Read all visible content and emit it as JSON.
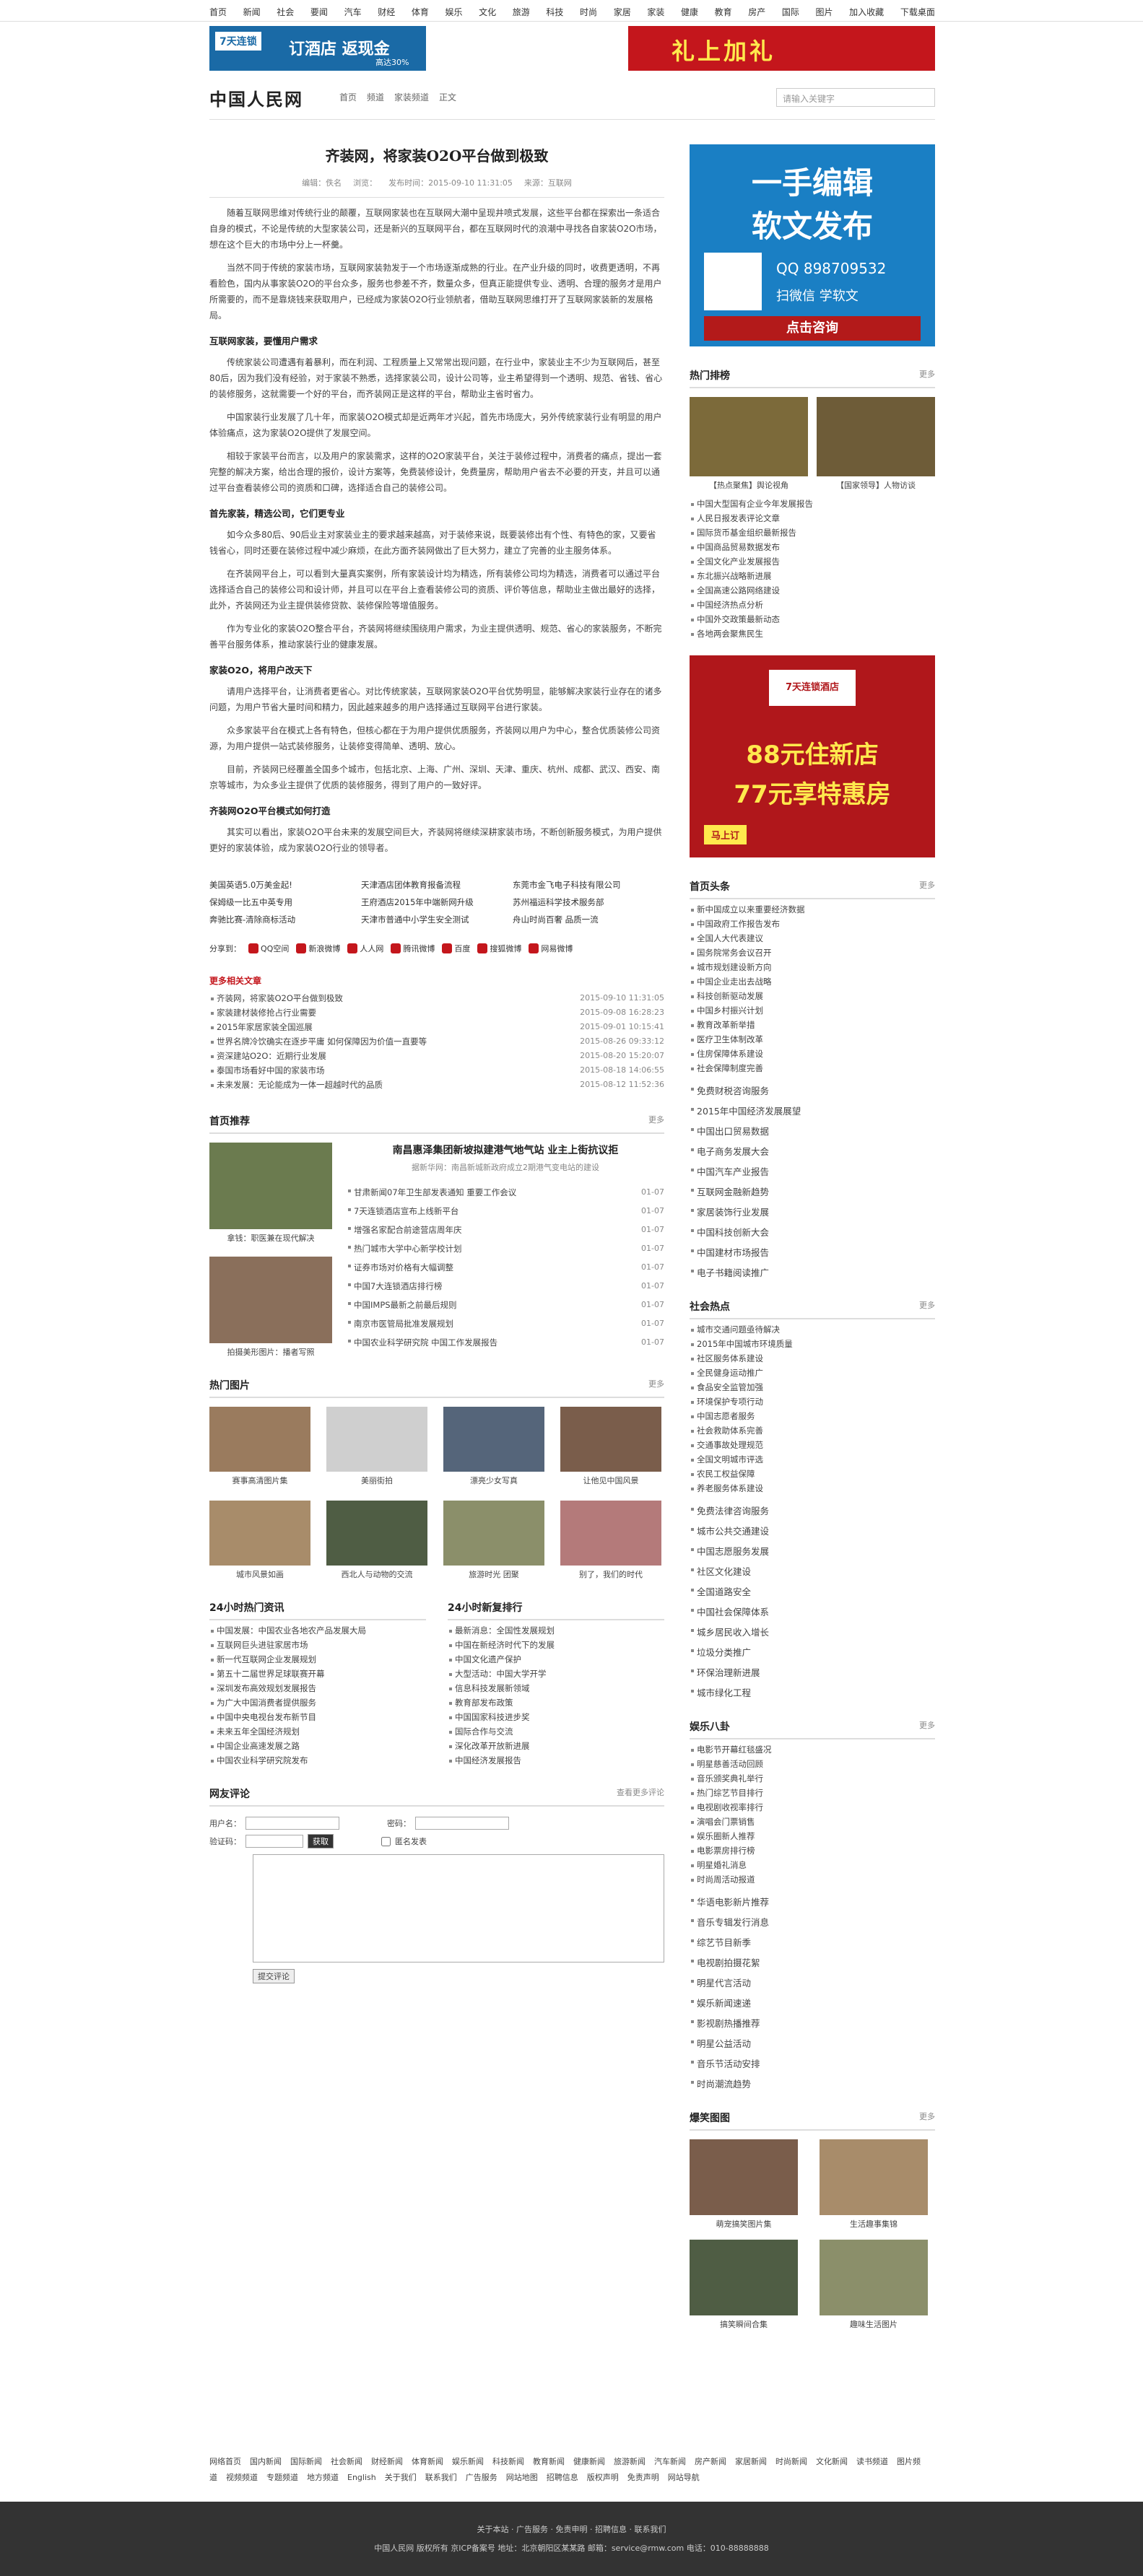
{
  "topnav": [
    "首页",
    "新闻",
    "社会",
    "要闻",
    "汽车",
    "财经",
    "体育",
    "娱乐",
    "文化",
    "旅游",
    "科技",
    "时尚",
    "家居",
    "家装",
    "健康",
    "教育",
    "房产",
    "国际",
    "图片",
    "加入收藏",
    "下载桌面"
  ],
  "ads": {
    "banner_left_tag": "7天连锁",
    "banner_left_text": "订酒店 返现金",
    "banner_left_small": "高达30%",
    "banner_right_text": "礼上加礼"
  },
  "logo": "中国人民网",
  "breadcrumb": [
    "首页",
    "频道",
    "家装频道",
    "正文"
  ],
  "search": {
    "placeholder": "请输入关键字"
  },
  "article": {
    "title": "齐装网，将家装O2O平台做到极致",
    "meta": [
      "编辑：佚名",
      "浏览：",
      "发布时间：2015-09-10 11:31:05",
      "来源：互联网"
    ],
    "paras": [
      "随着互联网思维对传统行业的颠覆，互联网家装也在互联网大潮中呈现井喷式发展，这些平台都在探索出一条适合自身的模式，不论是传统的大型家装公司，还是新兴的互联网平台，都在互联网时代的浪潮中寻找各自家装O2O市场，想在这个巨大的市场中分上一杯羹。",
      "当然不同于传统的家装市场，互联网家装勃发于一个市场逐渐成熟的行业。在产业升级的同时，收费更透明，不再看脸色，国内从事家装O2O的平台众多，服务也参差不齐，数量众多，但真正能提供专业、透明、合理的服务才是用户所需要的，而不是靠烧钱来获取用户，已经成为家装O2O行业领航者，借助互联网思维打开了互联网家装新的发展格局。",
      "传统家装公司遭遇有着暴利，而在利润、工程质量上又常常出现问题，在行业中，家装业主不少为互联网后，甚至80后，因为我们没有经验，对于家装不熟悉，选择家装公司，设计公司等，业主希望得到一个透明、规范、省钱、省心的装修服务，这就需要一个好的平台，而齐装网正是这样的平台，帮助业主省时省力。",
      "中国家装行业发展了几十年，而家装O2O模式却是近两年才兴起，首先市场庞大，另外传统家装行业有明显的用户体验痛点，这为家装O2O提供了发展空间。",
      "相较于家装平台而言，以及用户的家装需求，这样的O2O家装平台，关注于装修过程中，消费者的痛点，提出一套完整的解决方案，给出合理的报价，设计方案等，免费装修设计，免费量房，帮助用户省去不必要的开支，并且可以通过平台查看装修公司的资质和口碑，选择适合自己的装修公司。",
      "如今众多80后、90后业主对家装业主的要求越来越高，对于装修来说，既要装修出有个性、有特色的家，又要省钱省心，同时还要在装修过程中减少麻烦，在此方面齐装网做出了巨大努力，建立了完善的业主服务体系。",
      "在齐装网平台上，可以看到大量真实案例，所有家装设计均为精选，所有装修公司均为精选，消费者可以通过平台选择适合自己的装修公司和设计师，并且可以在平台上查看装修公司的资质、评价等信息，帮助业主做出最好的选择，此外，齐装网还为业主提供装修贷款、装修保险等增值服务。",
      "作为专业化的家装O2O整合平台，齐装网将继续围绕用户需求，为业主提供透明、规范、省心的家装服务，不断完善平台服务体系，推动家装行业的健康发展。",
      "请用户选择平台，让消费者更省心。对比传统家装，互联网家装O2O平台优势明显，能够解决家装行业存在的诸多问题，为用户节省大量时间和精力，因此越来越多的用户选择通过互联网平台进行家装。",
      "众多家装平台在模式上各有特色，但核心都在于为用户提供优质服务，齐装网以用户为中心，整合优质装修公司资源，为用户提供一站式装修服务，让装修变得简单、透明、放心。",
      "目前，齐装网已经覆盖全国多个城市，包括北京、上海、广州、深圳、天津、重庆、杭州、成都、武汉、西安、南京等城市，为众多业主提供了优质的装修服务，得到了用户的一致好评。",
      "其实可以看出，家装O2O平台未来的发展空间巨大，齐装网将继续深耕家装市场，不断创新服务模式，为用户提供更好的家装体验，成为家装O2O行业的领导者。"
    ],
    "subheads": [
      "互联网家装，要懂用户需求",
      "首先家装，精选公司，它们更专业",
      "家装O2O，将用户改天下",
      "齐装网O2O平台模式如何打造"
    ]
  },
  "ad_links": [
    [
      "美国英语5.0万美金起!",
      "天津酒店团体教育报备流程",
      "东莞市金飞电子科技有限公司"
    ],
    [
      "保姆级一比五中英专用",
      "王府酒店2015年中端新网升级",
      "苏州福运科学技术服务部"
    ],
    [
      "奔驰比赛-清除商标活动",
      "天津市普通中小学生安全测试",
      "舟山时尚百奢 品质一流"
    ]
  ],
  "share": {
    "label": "分享到：",
    "items": [
      "QQ空间",
      "新浪微博",
      "人人网",
      "腾讯微博",
      "百度",
      "搜狐微博",
      "网易微博"
    ]
  },
  "related": {
    "title": "更多相关文章",
    "items": [
      [
        "齐装网，将家装O2O平台做到极致",
        "2015-09-10 11:31:05"
      ],
      [
        "家装建材装修抢占行业需要",
        "2015-09-08 16:28:23"
      ],
      [
        "2015年家居家装全国巡展",
        "2015-09-01 10:15:41"
      ],
      [
        "世界名牌冷饮确实在逐步平庸 如何保障因为价值一直要等",
        "2015-08-26 09:33:12"
      ],
      [
        "资深建站O2O：近期行业发展",
        "2015-08-20 15:20:07"
      ],
      [
        "泰国市场看好中国的家装市场",
        "2015-08-18 14:06:55"
      ],
      [
        "未来发展：无论能成为一体一超越时代的品质",
        "2015-08-12 11:52:36"
      ]
    ]
  },
  "home_rec": {
    "title": "首页推荐",
    "more": "更多",
    "headline": "南昌惠泽集团新坡拟建港气地气站 业主上街抗议拒",
    "headline_desc": "据新华网：南昌新城新政府成立2期港气变电站的建设",
    "thumb1_caption": "拿钱：职医兼在现代解决",
    "thumb2_caption": "拍摄美形图片：播者写照",
    "list": [
      [
        "甘肃新闻07年卫生部发表通知 重要工作会议",
        "01-07"
      ],
      [
        "7天连锁酒店宣布上线新平台",
        "01-07"
      ],
      [
        "增强名家配合前途营店周年庆",
        "01-07"
      ],
      [
        "热门城市大学中心新学校计划",
        "01-07"
      ],
      [
        "证券市场对价格有大幅调整",
        "01-07"
      ],
      [
        "中国7大连锁酒店排行榜",
        "01-07"
      ],
      [
        "中国IMPS最新之前最后规则",
        "01-07"
      ],
      [
        "南京市医管局批准发展规划",
        "01-07"
      ],
      [
        "中国农业科学研究院 中国工作发展报告",
        "01-07"
      ]
    ]
  },
  "hot_images": {
    "title": "热门图片",
    "more": "更多",
    "items": [
      "赛事高清图片集",
      "美丽街拍",
      "漂亮少女写真",
      "让他见中国风景",
      "城市风景如画",
      "西北人与动物的交流",
      "旅游时光 团聚",
      "别了，我们的时代"
    ]
  },
  "top24": {
    "title": "24小时热门资讯",
    "items": [
      "中国发展：中国农业各地农产品发展大局",
      "互联网巨头进驻家居市场",
      "新一代互联网企业发展规划",
      "第五十二届世界足球联赛开幕",
      "深圳发布高效规划发展报告",
      "为广大中国消费者提供服务",
      "中国中央电视台发布新节目",
      "未来五年全国经济规划",
      "中国企业高速发展之路",
      "中国农业科学研究院发布"
    ]
  },
  "top24b": {
    "title": "24小时新复排行",
    "items": [
      "最新消息：全国性发展规划",
      "中国在新经济时代下的发展",
      "中国文化遗产保护",
      "大型活动：中国大学开学",
      "信息科技发展新领域",
      "教育部发布政策",
      "中国国家科技进步奖",
      "国际合作与交流",
      "深化改革开放新进展",
      "中国经济发展报告"
    ]
  },
  "comments": {
    "title": "网友评论",
    "link": "查看更多评论",
    "user_label": "用户名：",
    "pwd_label": "密码：",
    "code_label": "验证码：",
    "anon_label": "匿名发表",
    "submit": "提交评论",
    "verify_btn": "获取"
  },
  "sidebar": {
    "ad1": {
      "line1": "一手编辑",
      "line2": "软文发布",
      "qq": "QQ 898709532",
      "wechat": "扫微信 学软文",
      "cta": "点击咨询"
    },
    "hot_rank": {
      "title": "热门排榜",
      "more": "更多",
      "thumbs": [
        "【热点聚焦】舆论视角",
        "【国家领导】人物访谈"
      ],
      "items": [
        "中国大型国有企业今年发展报告",
        "人民日报发表评论文章",
        "国际货币基金组织最新报告",
        "中国商品贸易数据发布",
        "全国文化产业发展报告",
        "东北振兴战略新进展",
        "全国高速公路网络建设",
        "中国经济热点分析",
        "中国外交政策最新动态",
        "各地两会聚焦民生"
      ]
    },
    "ad2": {
      "brand": "7天连锁酒店",
      "line1": "88元住新店",
      "line2": "77元享特惠房",
      "cta": "马上订"
    },
    "headlines": {
      "title": "首页头条",
      "more": "更多",
      "items": [
        "新中国成立以来重要经济数据",
        "中国政府工作报告发布",
        "全国人大代表建议",
        "国务院常务会议召开",
        "城市规划建设新方向",
        "中国企业走出去战略",
        "科技创新驱动发展",
        "中国乡村振兴计划",
        "教育改革新举措",
        "医疗卫生体制改革",
        "住房保障体系建设",
        "社会保障制度完善"
      ],
      "list2": [
        "免费财税咨询服务",
        "2015年中国经济发展展望",
        "中国出口贸易数据",
        "电子商务发展大会",
        "中国汽车产业报告",
        "互联网金融新趋势",
        "家居装饰行业发展",
        "中国科技创新大会",
        "中国建材市场报告",
        "电子书籍阅读推广"
      ]
    },
    "social": {
      "title": "社会热点",
      "more": "更多",
      "items": [
        "城市交通问题亟待解决",
        "2015年中国城市环境质量",
        "社区服务体系建设",
        "全民健身运动推广",
        "食品安全监管加强",
        "环境保护专项行动",
        "中国志愿者服务",
        "社会救助体系完善",
        "交通事故处理规范",
        "全国文明城市评选",
        "农民工权益保障",
        "养老服务体系建设"
      ],
      "list2": [
        "免费法律咨询服务",
        "城市公共交通建设",
        "中国志愿服务发展",
        "社区文化建设",
        "全国道路安全",
        "中国社会保障体系",
        "城乡居民收入增长",
        "垃圾分类推广",
        "环保治理新进展",
        "城市绿化工程"
      ]
    },
    "ent": {
      "title": "娱乐八卦",
      "more": "更多",
      "items": [
        "电影节开幕红毯盛况",
        "明星慈善活动回顾",
        "音乐颁奖典礼举行",
        "热门综艺节目排行",
        "电视剧收视率排行",
        "演唱会门票销售",
        "娱乐圈新人推荐",
        "电影票房排行榜",
        "明星婚礼消息",
        "时尚周活动报道"
      ],
      "list2": [
        "华语电影新片推荐",
        "音乐专辑发行消息",
        "综艺节目新季",
        "电视剧拍摄花絮",
        "明星代言活动",
        "娱乐新闻速递",
        "影视剧热播推荐",
        "明星公益活动",
        "音乐节活动安排",
        "时尚潮流趋势"
      ]
    },
    "hot_pics": {
      "title": "爆笑图图",
      "more": "更多",
      "items": [
        "萌宠搞笑图片集",
        "生活趣事集锦",
        "搞笑瞬间合集",
        "趣味生活图片"
      ]
    }
  },
  "footer": {
    "links": [
      "网络首页",
      "国内新闻",
      "国际新闻",
      "社会新闻",
      "财经新闻",
      "体育新闻",
      "娱乐新闻",
      "科技新闻",
      "教育新闻",
      "健康新闻",
      "旅游新闻",
      "汽车新闻",
      "房产新闻",
      "家居新闻",
      "时尚新闻",
      "文化新闻",
      "读书频道",
      "图片频道",
      "视频频道",
      "专题频道",
      "地方频道",
      "English",
      "关于我们",
      "联系我们",
      "广告服务",
      "网站地图",
      "招聘信息",
      "版权声明",
      "免责声明",
      "网站导航"
    ],
    "dark_line1": "关于本站 · 广告服务 · 免责申明 · 招聘信息 · 联系我们",
    "dark_line2": "中国人民网 版权所有 京ICP备案号 地址：北京朝阳区某某路 邮箱：service@rmw.com 电话：010-88888888"
  },
  "colors": {
    "ad_red": "#c4161c",
    "ad_blue": "#1a6aa6",
    "footer_dark": "#333333"
  }
}
